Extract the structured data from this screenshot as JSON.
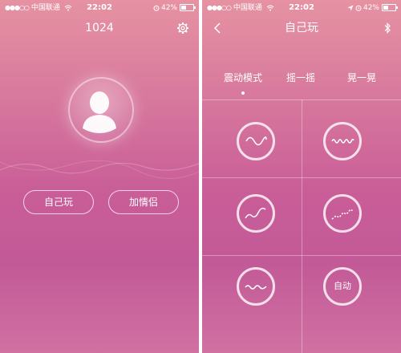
{
  "left": {
    "status": {
      "carrier": "中国联通",
      "time": "22:02",
      "battery": "42%"
    },
    "title": "1024",
    "buttons": {
      "solo": "自己玩",
      "partner": "加情侣"
    }
  },
  "right": {
    "status": {
      "carrier": "中国联通",
      "time": "22:02",
      "battery": "42%"
    },
    "title": "自己玩",
    "modes": [
      "震动模式",
      "摇一摇",
      "晃一晃"
    ],
    "auto_label": "自动"
  },
  "icons": {
    "settings": "gear-icon",
    "back": "back-chevron-icon",
    "bluetooth": "bluetooth-icon",
    "wifi": "wifi-icon",
    "alarm": "alarm-icon",
    "location": "location-arrow-icon"
  },
  "colors": {
    "gradient_top": "#e692a2",
    "gradient_mid": "#c95d98",
    "gradient_bottom": "#d171a2"
  }
}
